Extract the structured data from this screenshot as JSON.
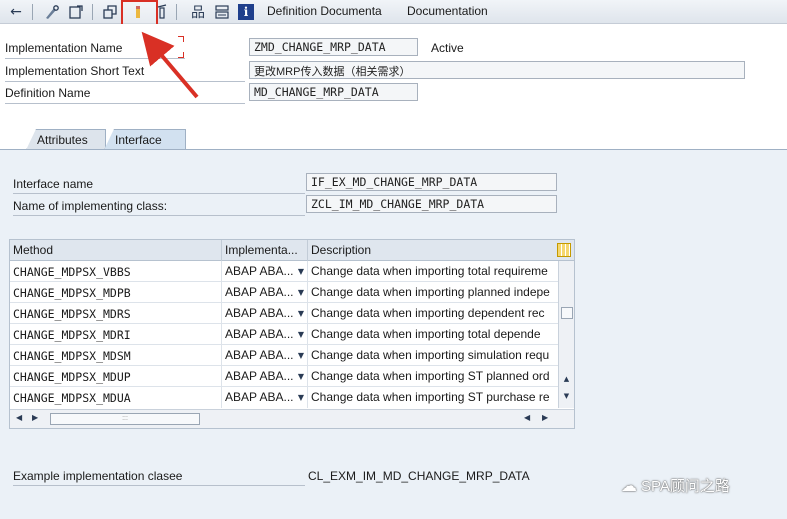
{
  "toolbar": {
    "definition_doc_label": "Definition Documenta",
    "documentation_label": "Documentation"
  },
  "header": {
    "impl_name_label": "Implementation Name",
    "impl_name_value": "ZMD_CHANGE_MRP_DATA",
    "status": "Active",
    "short_text_label": "Implementation Short Text",
    "short_text_value": "更改MRP传入数据（相关需求）",
    "def_name_label": "Definition Name",
    "def_name_value": "MD_CHANGE_MRP_DATA"
  },
  "tabs": [
    {
      "label": "Attributes",
      "active": false
    },
    {
      "label": "Interface",
      "active": true
    }
  ],
  "interface": {
    "interface_name_label": "Interface name",
    "interface_name_value": "IF_EX_MD_CHANGE_MRP_DATA",
    "impl_class_label": "Name of implementing class:",
    "impl_class_value": "ZCL_IM_MD_CHANGE_MRP_DATA"
  },
  "table": {
    "columns": [
      "Method",
      "Implementa...",
      "Description"
    ],
    "rows": [
      {
        "method": "CHANGE_MDPSX_VBBS",
        "impl": "ABAP ABA...",
        "desc": "Change data when importing total requireme"
      },
      {
        "method": "CHANGE_MDPSX_MDPB",
        "impl": "ABAP ABA...",
        "desc": "Change data when importing planned indepe"
      },
      {
        "method": "CHANGE_MDPSX_MDRS",
        "impl": "ABAP ABA...",
        "desc": "Change data when importing dependent rec"
      },
      {
        "method": "CHANGE_MDPSX_MDRI",
        "impl": "ABAP ABA...",
        "desc": "Change data when importing total depende"
      },
      {
        "method": "CHANGE_MDPSX_MDSM",
        "impl": "ABAP ABA...",
        "desc": "Change data when importing simulation requ"
      },
      {
        "method": "CHANGE_MDPSX_MDUP",
        "impl": "ABAP ABA...",
        "desc": "Change data when importing ST planned ord"
      },
      {
        "method": "CHANGE_MDPSX_MDUA",
        "impl": "ABAP ABA...",
        "desc": "Change data when importing ST purchase re"
      }
    ]
  },
  "example": {
    "label": "Example implementation clasee",
    "value": "CL_EXM_IM_MD_CHANGE_MRP_DATA"
  },
  "watermark": {
    "text": "SPA顾问之路"
  },
  "icons": {
    "back": "←",
    "tools": "✎",
    "hierarchy": "品",
    "info": "i",
    "dropdown": "▼",
    "scroll_up": "▲",
    "scroll_down": "▼",
    "scroll_left": "◀",
    "scroll_right": "▶",
    "wechat": "☁"
  },
  "colors": {
    "highlight": "#d93025",
    "panel_bg": "#ebf1f7",
    "tab_active": "#d2e1f0"
  }
}
